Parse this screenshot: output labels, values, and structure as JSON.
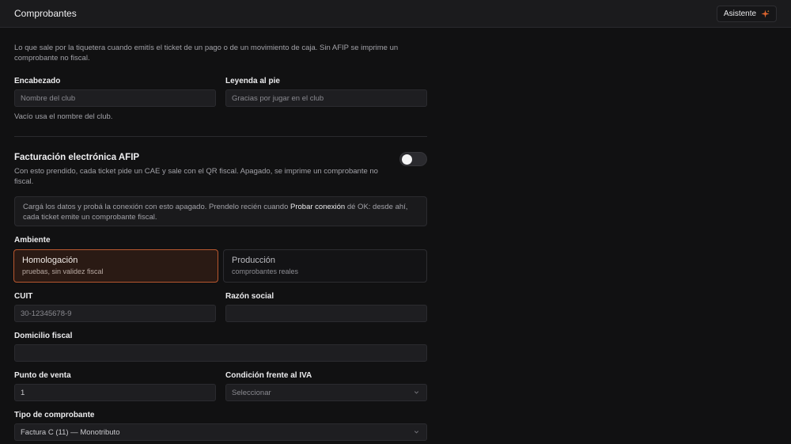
{
  "header": {
    "title": "Comprobantes",
    "assistant_label": "Asistente",
    "assistant_icon": "sparkle-icon",
    "accent": "#e2662f"
  },
  "intro": "Lo que sale por la tiquetera cuando emitís el ticket de un pago o de un movimiento de caja. Sin AFIP se imprime un comprobante no fiscal.",
  "encabezado": {
    "label": "Encabezado",
    "placeholder": "Nombre del club",
    "value": "",
    "help": "Vacío usa el nombre del club."
  },
  "leyenda": {
    "label": "Leyenda al pie",
    "placeholder": "Gracias por jugar en el club",
    "value": ""
  },
  "afip": {
    "title": "Facturación electrónica AFIP",
    "description": "Con esto prendido, cada ticket pide un CAE y sale con el QR fiscal. Apagado, se imprime un comprobante no fiscal.",
    "enabled": false,
    "note_before": "Cargá los datos y probá la conexión con esto apagado. Prendelo recién cuando ",
    "note_link": "Probar conexión",
    "note_after": " dé OK: desde ahí, cada ticket emite un comprobante fiscal."
  },
  "ambiente": {
    "label": "Ambiente",
    "options": [
      {
        "title": "Homologación",
        "subtitle": "pruebas, sin validez fiscal",
        "selected": true
      },
      {
        "title": "Producción",
        "subtitle": "comprobantes reales",
        "selected": false
      }
    ]
  },
  "cuit": {
    "label": "CUIT",
    "placeholder": "30-12345678-9",
    "value": ""
  },
  "razon_social": {
    "label": "Razón social",
    "value": ""
  },
  "domicilio": {
    "label": "Domicilio fiscal",
    "value": ""
  },
  "punto_venta": {
    "label": "Punto de venta",
    "value": "1"
  },
  "iva": {
    "label": "Condición frente al IVA",
    "selected": "Seleccionar"
  },
  "tipo": {
    "label": "Tipo de comprobante",
    "selected": "Factura C (11) — Monotributo"
  }
}
